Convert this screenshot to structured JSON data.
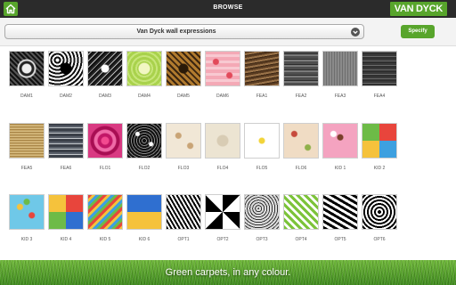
{
  "header": {
    "title": "BROWSE",
    "home_icon": "home-icon",
    "brand": "VAN DYCK"
  },
  "toolbar": {
    "selected_collection": "Van Dyck wall expressions",
    "dropdown_icon": "chevron-down-icon",
    "specify_label": "Specify"
  },
  "swatches": [
    {
      "code": "DAM1"
    },
    {
      "code": "DAM2"
    },
    {
      "code": "DAM3"
    },
    {
      "code": "DAM4"
    },
    {
      "code": "DAM5"
    },
    {
      "code": "DAM6"
    },
    {
      "code": "FEA1"
    },
    {
      "code": "FEA2"
    },
    {
      "code": "FEA3"
    },
    {
      "code": "FEA4"
    },
    {
      "code": "FEA5"
    },
    {
      "code": "FEA6"
    },
    {
      "code": "FLO1"
    },
    {
      "code": "FLO2"
    },
    {
      "code": "FLO3"
    },
    {
      "code": "FLO4"
    },
    {
      "code": "FLO5"
    },
    {
      "code": "FLO6"
    },
    {
      "code": "KID 1"
    },
    {
      "code": "KID 2"
    },
    {
      "code": "KID 3"
    },
    {
      "code": "KID 4"
    },
    {
      "code": "KID 5"
    },
    {
      "code": "KID 6"
    },
    {
      "code": "OPT1"
    },
    {
      "code": "OPT2"
    },
    {
      "code": "OPT3"
    },
    {
      "code": "OPT4"
    },
    {
      "code": "OPT5"
    },
    {
      "code": "OPT6"
    }
  ],
  "footer": {
    "tagline": "Green carpets, in any colour."
  },
  "colors": {
    "brand_green": "#58a52c",
    "topbar": "#2b2b2b"
  }
}
